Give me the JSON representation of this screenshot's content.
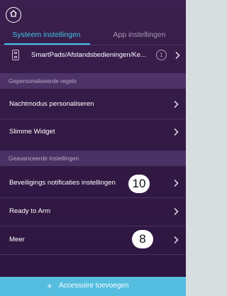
{
  "tabs": {
    "system": "Systeem instellingen",
    "app": "App instellingen"
  },
  "device_row": {
    "label": "SmartPads/Afstandsbedieningen/Ke...",
    "count": "1"
  },
  "sections": {
    "personalized": "Gepersonaliseerde regels",
    "advanced": "Geavanceerde instellingen"
  },
  "menu": {
    "night_mode": "Nachtmodus personaliseren",
    "smart_widget": "Slimme Widget",
    "security_notifications": "Beveiligings notificaties instellingen",
    "ready_to_arm": "Ready to Arm",
    "more": "Meer"
  },
  "callouts": {
    "c10": "10",
    "c8": "8"
  },
  "bottom": {
    "plus": "+",
    "label": "Accessoire toevoegen"
  },
  "colors": {
    "accent": "#3fc7e6",
    "background": "#341a46",
    "bottom_bar": "#55bde0"
  },
  "icons": [
    "home-icon",
    "remote-icon",
    "chevron-right-icon",
    "plus-icon"
  ]
}
